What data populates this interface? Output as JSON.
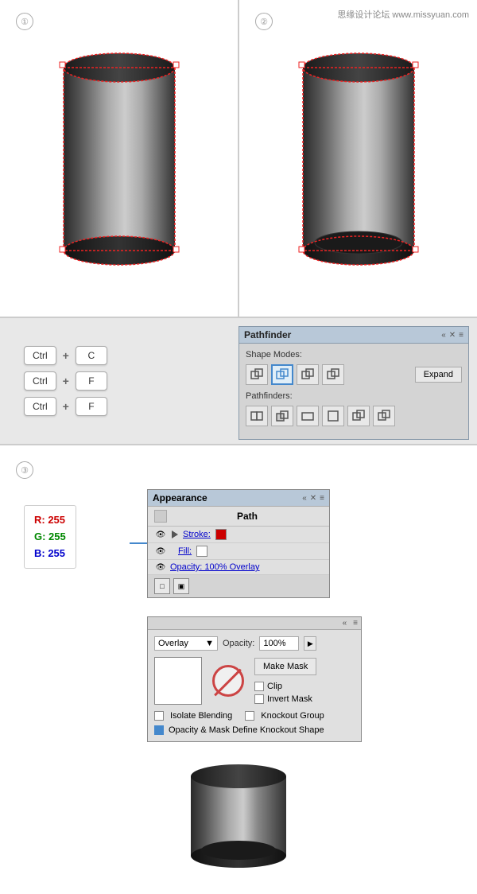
{
  "watermark": {
    "text": "思缘设计论坛 www.missyuan.com"
  },
  "steps": {
    "step1": "①",
    "step2": "②",
    "step3": "③"
  },
  "keyboard": {
    "rows": [
      {
        "keys": [
          "Ctrl",
          "+",
          "C"
        ]
      },
      {
        "keys": [
          "Ctrl",
          "+",
          "F"
        ]
      },
      {
        "keys": [
          "Ctrl",
          "+",
          "F"
        ]
      }
    ]
  },
  "pathfinder": {
    "title": "Pathfinder",
    "shape_modes_label": "Shape Modes:",
    "pathfinders_label": "Pathfinders:",
    "expand_label": "Expand"
  },
  "appearance": {
    "title": "Appearance",
    "path_label": "Path",
    "stroke_label": "Stroke:",
    "fill_label": "Fill:",
    "opacity_label": "Opacity: 100% Overlay"
  },
  "transparency": {
    "blend_mode": "Overlay",
    "opacity_label": "Opacity:",
    "opacity_value": "100%",
    "make_mask_label": "Make Mask",
    "clip_label": "Clip",
    "invert_mask_label": "Invert Mask",
    "isolate_blending_label": "Isolate Blending",
    "knockout_group_label": "Knockout Group",
    "opacity_define_label": "Opacity & Mask Define Knockout Shape"
  },
  "rgb": {
    "r": "R: 255",
    "g": "G: 255",
    "b": "B: 255"
  }
}
